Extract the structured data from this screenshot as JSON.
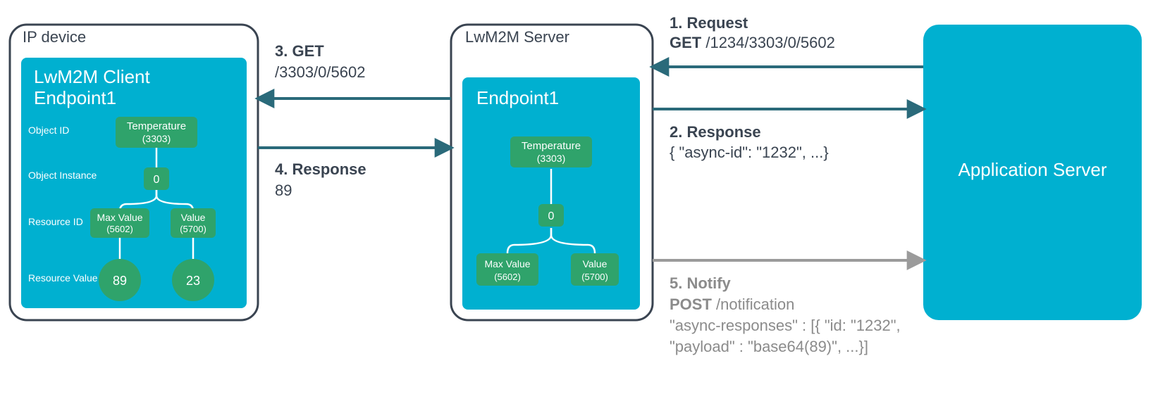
{
  "colors": {
    "dark": "#3a4451",
    "teal": "#00b0d0",
    "green": "#2fa36b",
    "grey": "#8b8b8b",
    "arrow": "#2a6a7a"
  },
  "ip_device": {
    "title": "IP device",
    "client_title1": "LwM2M Client",
    "client_title2": "Endpoint1",
    "row_labels": {
      "object_id": "Object ID",
      "object_instance": "Object Instance",
      "resource_id": "Resource ID",
      "resource_value": "Resource Value"
    },
    "tree": {
      "obj_name": "Temperature",
      "obj_id": "(3303)",
      "instance": "0",
      "res1_name": "Max Value",
      "res1_id": "(5602)",
      "res2_name": "Value",
      "res2_id": "(5700)",
      "val1": "89",
      "val2": "23"
    }
  },
  "server": {
    "title": "LwM2M Server",
    "endpoint_title": "Endpoint1",
    "tree": {
      "obj_name": "Temperature",
      "obj_id": "(3303)",
      "instance": "0",
      "res1_name": "Max Value",
      "res1_id": "(5602)",
      "res2_name": "Value",
      "res2_id": "(5700)"
    }
  },
  "app_server": {
    "title": "Application Server"
  },
  "msg1": {
    "hdr": "1. Request",
    "verb": "GET",
    "path": " /1234/3303/0/5602"
  },
  "msg2": {
    "hdr": "2. Response",
    "body": "{ \"async-id\": \"1232\", ...}"
  },
  "msg3": {
    "hdr": "3. GET",
    "path": "/3303/0/5602"
  },
  "msg4": {
    "hdr": "4. Response",
    "body": "89"
  },
  "msg5": {
    "hdr": "5. Notify",
    "verb": "POST",
    "path": " /notification",
    "body1": "\"async-responses\" : [{ \"id: \"1232\",",
    "body2": "\"payload\" : \"base64(89)\", ...}]"
  }
}
